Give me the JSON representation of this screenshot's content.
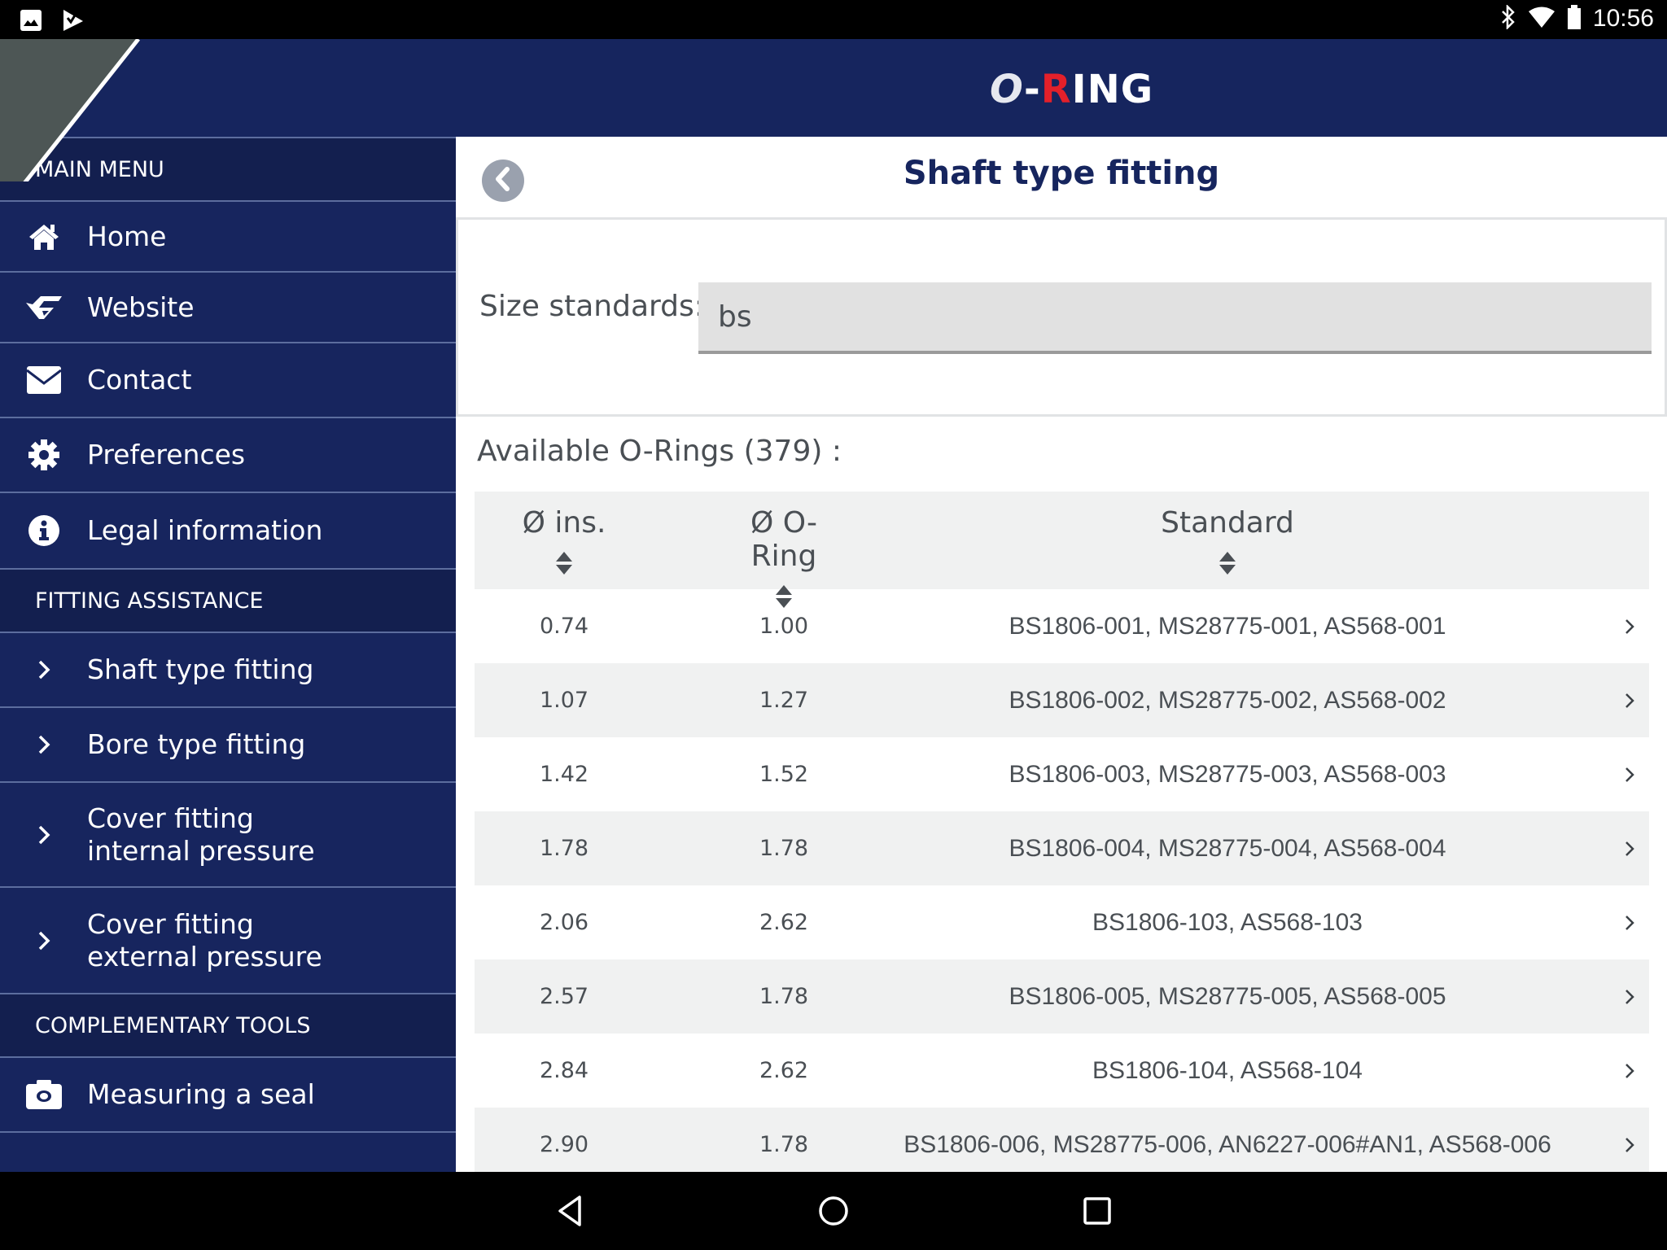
{
  "status_bar": {
    "left_icons": [
      "image-notification-icon",
      "task-check-notification-icon"
    ],
    "right_icons": [
      "bluetooth-icon",
      "wifi-icon",
      "battery-icon"
    ],
    "time": "10:56"
  },
  "app": {
    "logo": {
      "o": "O",
      "dash": "-",
      "r": "R",
      "rest": "ING"
    },
    "brand_colors": {
      "navy": "#16255e",
      "red": "#e3202a"
    }
  },
  "sidebar": {
    "sections": [
      {
        "title": "MAIN MENU",
        "items": [
          {
            "label": "Home",
            "icon": "home-icon"
          },
          {
            "label": "Website",
            "icon": "website-logo-icon"
          },
          {
            "label": "Contact",
            "icon": "envelope-icon"
          },
          {
            "label": "Preferences",
            "icon": "gear-icon"
          },
          {
            "label": "Legal information",
            "icon": "info-icon"
          }
        ]
      },
      {
        "title": "FITTING ASSISTANCE",
        "items": [
          {
            "label": "Shaft type fitting",
            "icon": "chevron-right-icon"
          },
          {
            "label": "Bore type fitting",
            "icon": "chevron-right-icon"
          },
          {
            "label_line1": "Cover fitting",
            "label_line2": "internal pressure",
            "icon": "chevron-right-icon"
          },
          {
            "label_line1": "Cover fitting",
            "label_line2": "external pressure",
            "icon": "chevron-right-icon"
          }
        ]
      },
      {
        "title": "COMPLEMENTARY TOOLS",
        "items": [
          {
            "label": "Measuring a seal",
            "icon": "camera-icon"
          }
        ]
      }
    ]
  },
  "page": {
    "title": "Shaft type fitting",
    "back_icon": "back-arrow-icon",
    "filter": {
      "label": "Size standards:",
      "value": "bs"
    },
    "available_label": "Available O-Rings (379) :",
    "table": {
      "columns": [
        "Ø ins.",
        "Ø O-Ring",
        "Standard"
      ],
      "rows": [
        {
          "ins": "0.74",
          "oring": "1.00",
          "standard": "BS1806-001, MS28775-001, AS568-001"
        },
        {
          "ins": "1.07",
          "oring": "1.27",
          "standard": "BS1806-002, MS28775-002, AS568-002"
        },
        {
          "ins": "1.42",
          "oring": "1.52",
          "standard": "BS1806-003, MS28775-003, AS568-003"
        },
        {
          "ins": "1.78",
          "oring": "1.78",
          "standard": "BS1806-004, MS28775-004, AS568-004"
        },
        {
          "ins": "2.06",
          "oring": "2.62",
          "standard": "BS1806-103, AS568-103"
        },
        {
          "ins": "2.57",
          "oring": "1.78",
          "standard": "BS1806-005, MS28775-005, AS568-005"
        },
        {
          "ins": "2.84",
          "oring": "2.62",
          "standard": "BS1806-104, AS568-104"
        },
        {
          "ins": "2.90",
          "oring": "1.78",
          "standard": "BS1806-006, MS28775-006, AN6227-006#AN1, AS568-006"
        }
      ]
    }
  },
  "nav_bar": {
    "buttons": [
      "back-nav-icon",
      "home-nav-icon",
      "recents-nav-icon"
    ]
  }
}
